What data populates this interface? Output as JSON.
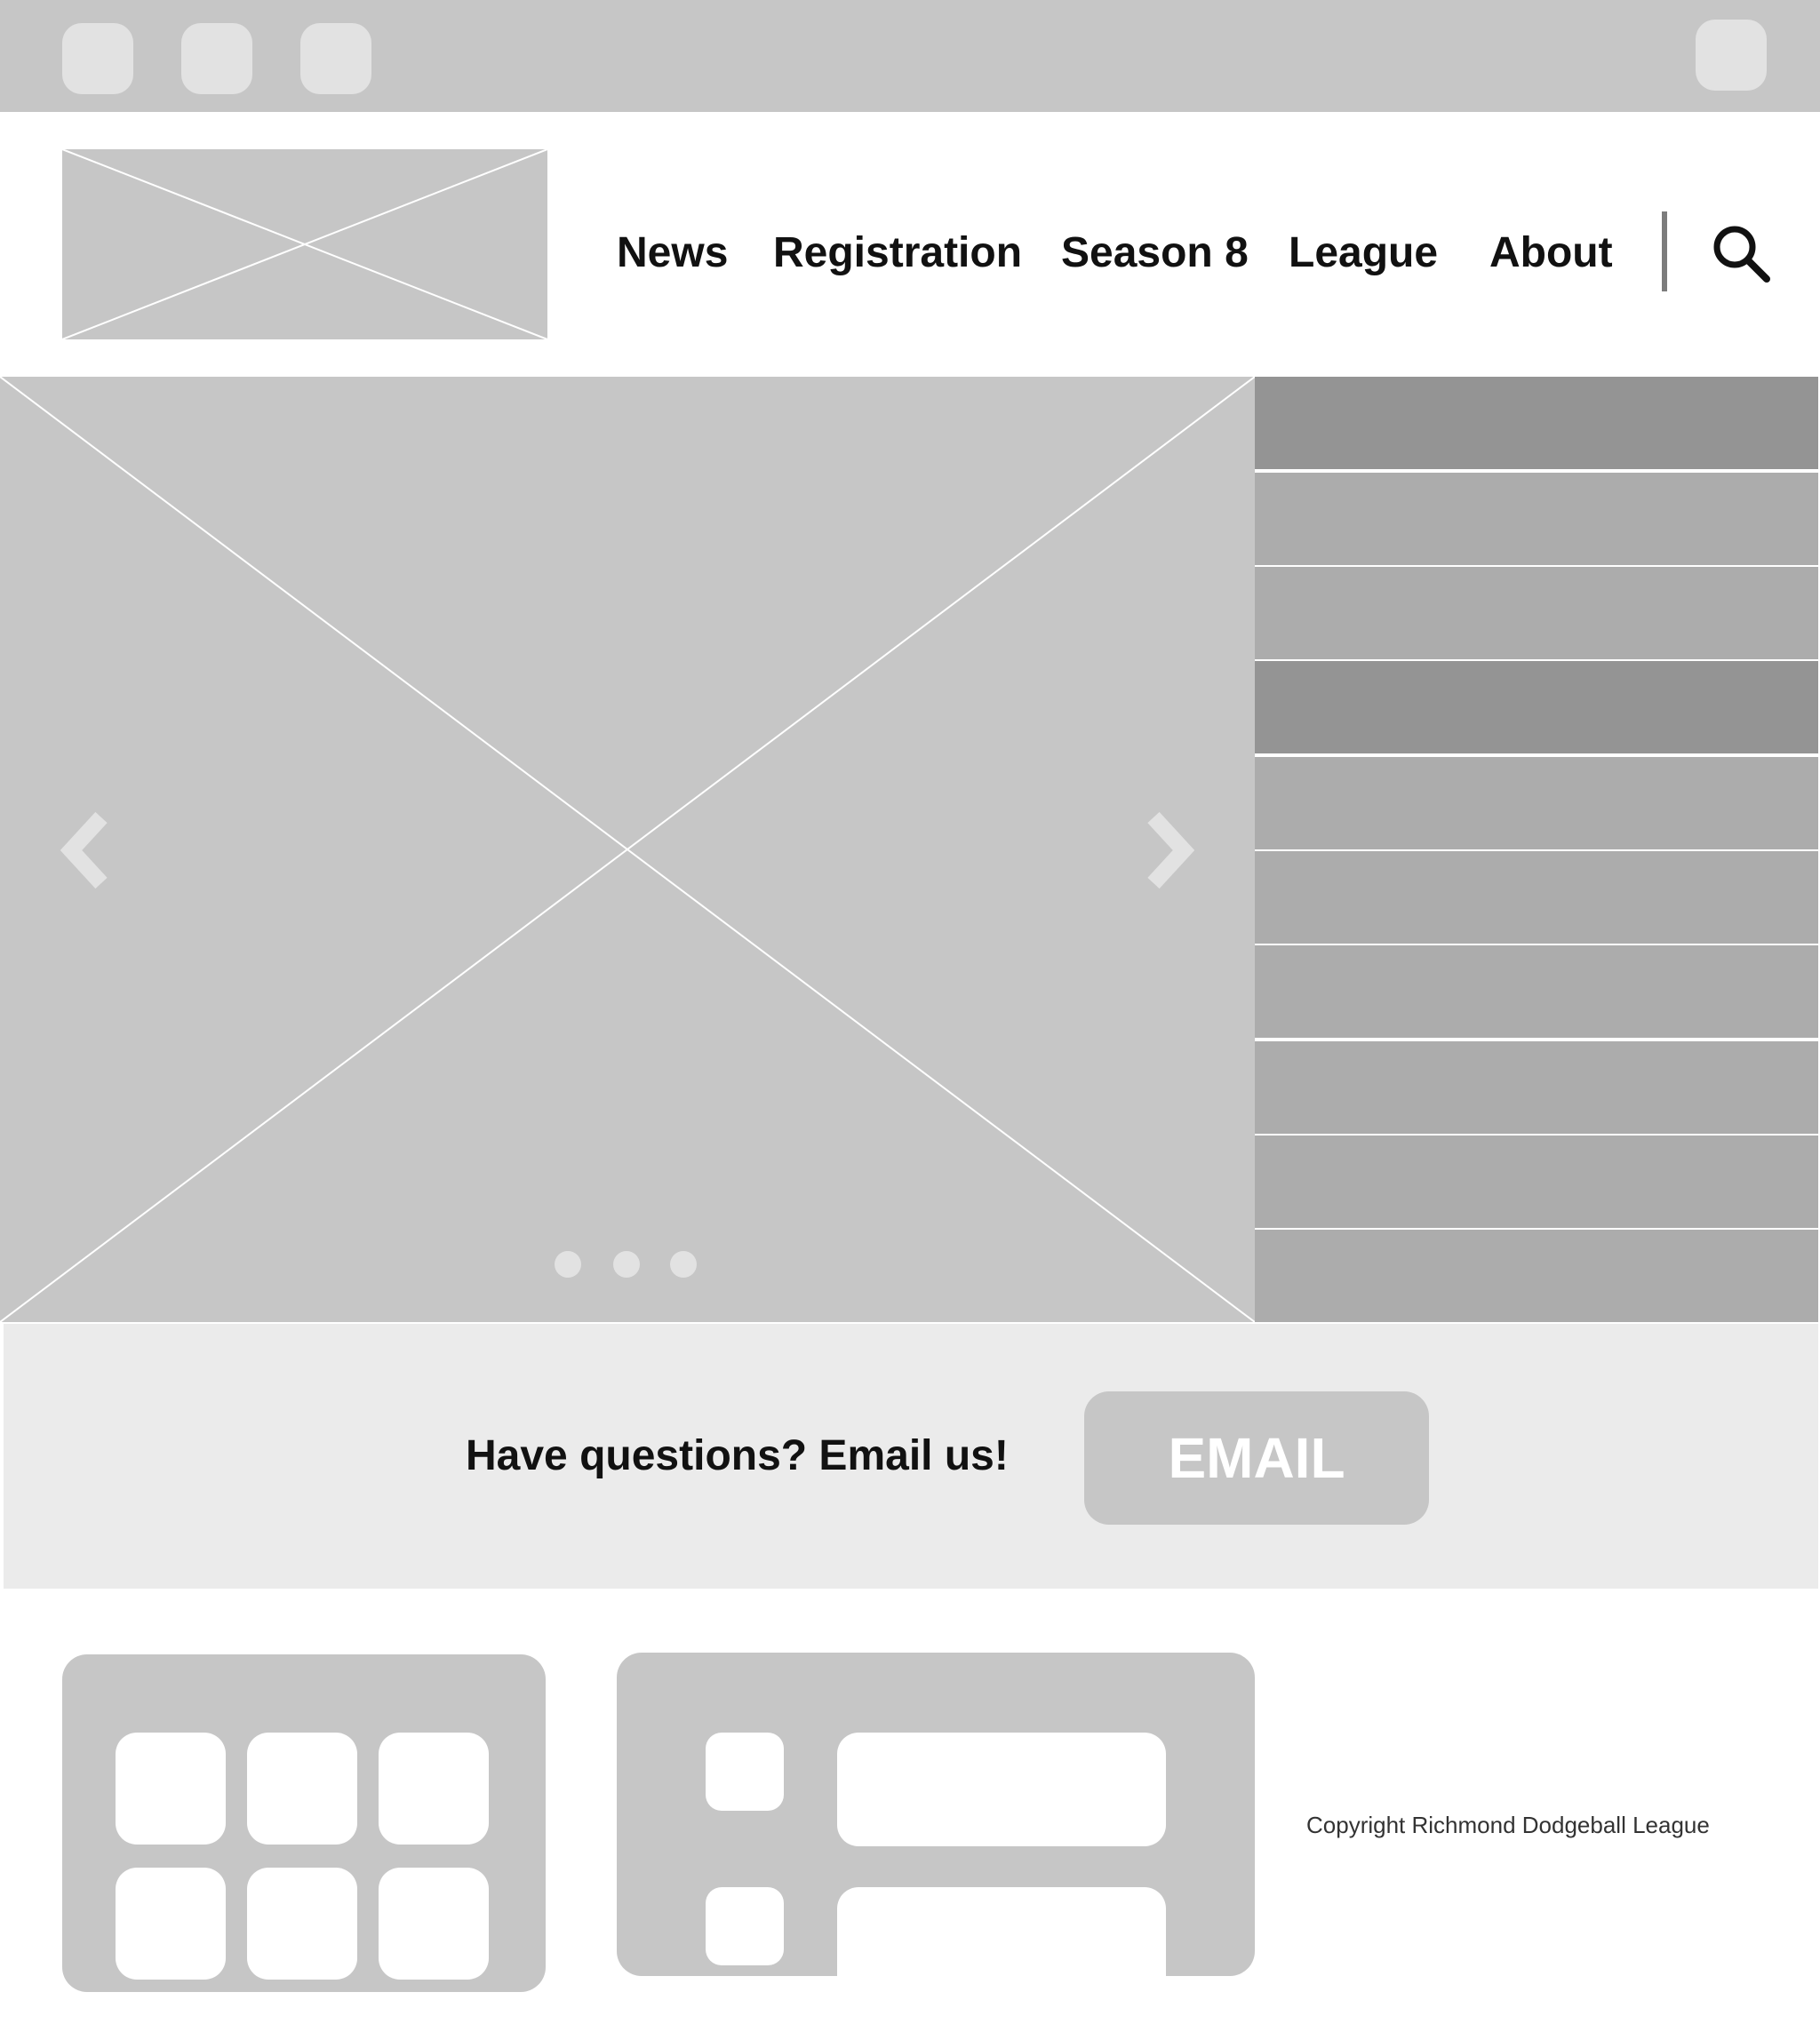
{
  "nav": {
    "items": [
      "News",
      "Registration",
      "Season 8",
      "League",
      "About"
    ],
    "search_icon": "search-icon"
  },
  "hero": {
    "prev_icon": "chevron-left-icon",
    "next_icon": "chevron-right-icon",
    "slide_count": 3
  },
  "cta": {
    "text": "Have questions? Email us!",
    "button_label": "EMAIL"
  },
  "footer": {
    "copyright": "Copyright Richmond Dodgeball League"
  },
  "colors": {
    "placeholder": "#c6c6c6",
    "sidebar_row": "#acacac",
    "sidebar_row_highlight": "#949494",
    "cta_band": "#ebebeb"
  }
}
